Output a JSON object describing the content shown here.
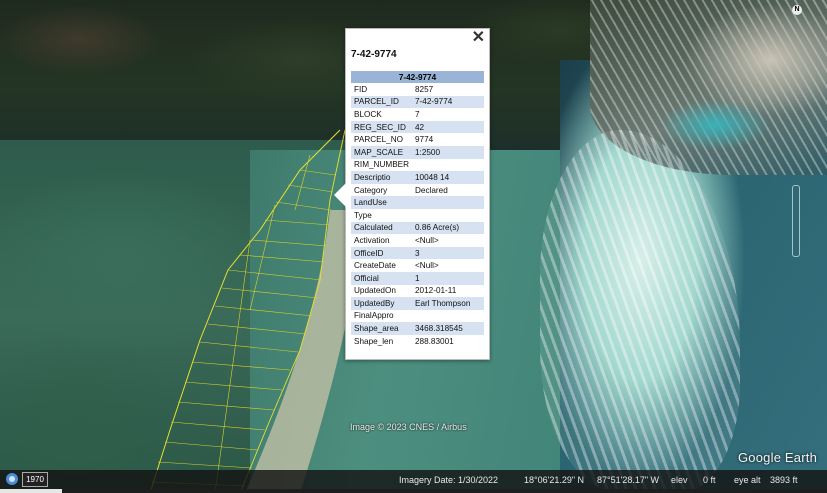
{
  "popup": {
    "title": "7-42-9774",
    "header": "7-42-9774",
    "close_label": "✕",
    "rows": [
      {
        "key": "FID",
        "value": "8257"
      },
      {
        "key": "PARCEL_ID",
        "value": "7-42-9774"
      },
      {
        "key": "BLOCK",
        "value": "7"
      },
      {
        "key": "REG_SEC_ID",
        "value": "42"
      },
      {
        "key": "PARCEL_NO",
        "value": "9774"
      },
      {
        "key": "MAP_SCALE",
        "value": "1:2500"
      },
      {
        "key": "RIM_NUMBER",
        "value": ""
      },
      {
        "key": "Descriptio",
        "value": "10048 14"
      },
      {
        "key": "Category",
        "value": "Declared"
      },
      {
        "key": "LandUse",
        "value": ""
      },
      {
        "key": "Type",
        "value": ""
      },
      {
        "key": "Calculated",
        "value": "0.86 Acre(s)"
      },
      {
        "key": "Activation",
        "value": "<Null>"
      },
      {
        "key": "OfficeID",
        "value": "3"
      },
      {
        "key": "CreateDate",
        "value": "<Null>"
      },
      {
        "key": "Official",
        "value": "1"
      },
      {
        "key": "UpdatedOn",
        "value": "2012-01-11"
      },
      {
        "key": "UpdatedBy",
        "value": "Earl Thompson"
      },
      {
        "key": "FinalAppro",
        "value": ""
      },
      {
        "key": "Shape_area",
        "value": "3468.318545"
      },
      {
        "key": "Shape_len",
        "value": "288.83001"
      }
    ]
  },
  "map": {
    "compass_label": "N",
    "attribution": "Image © 2023 CNES / Airbus",
    "logo": "Google Earth"
  },
  "statusbar": {
    "year": "1970",
    "imagery_date": "Imagery Date: 1/30/2022",
    "latitude": "18°06'21.29\" N",
    "longitude": "87°51'28.17\" W",
    "elev_label": "elev",
    "elev_value": "0 ft",
    "eye_alt_label": "eye alt",
    "eye_alt_value": "3893 ft"
  },
  "colors": {
    "parcel_line": "#e8e030",
    "table_header": "#99b4d6",
    "table_alt_row": "#d6e2f1"
  }
}
